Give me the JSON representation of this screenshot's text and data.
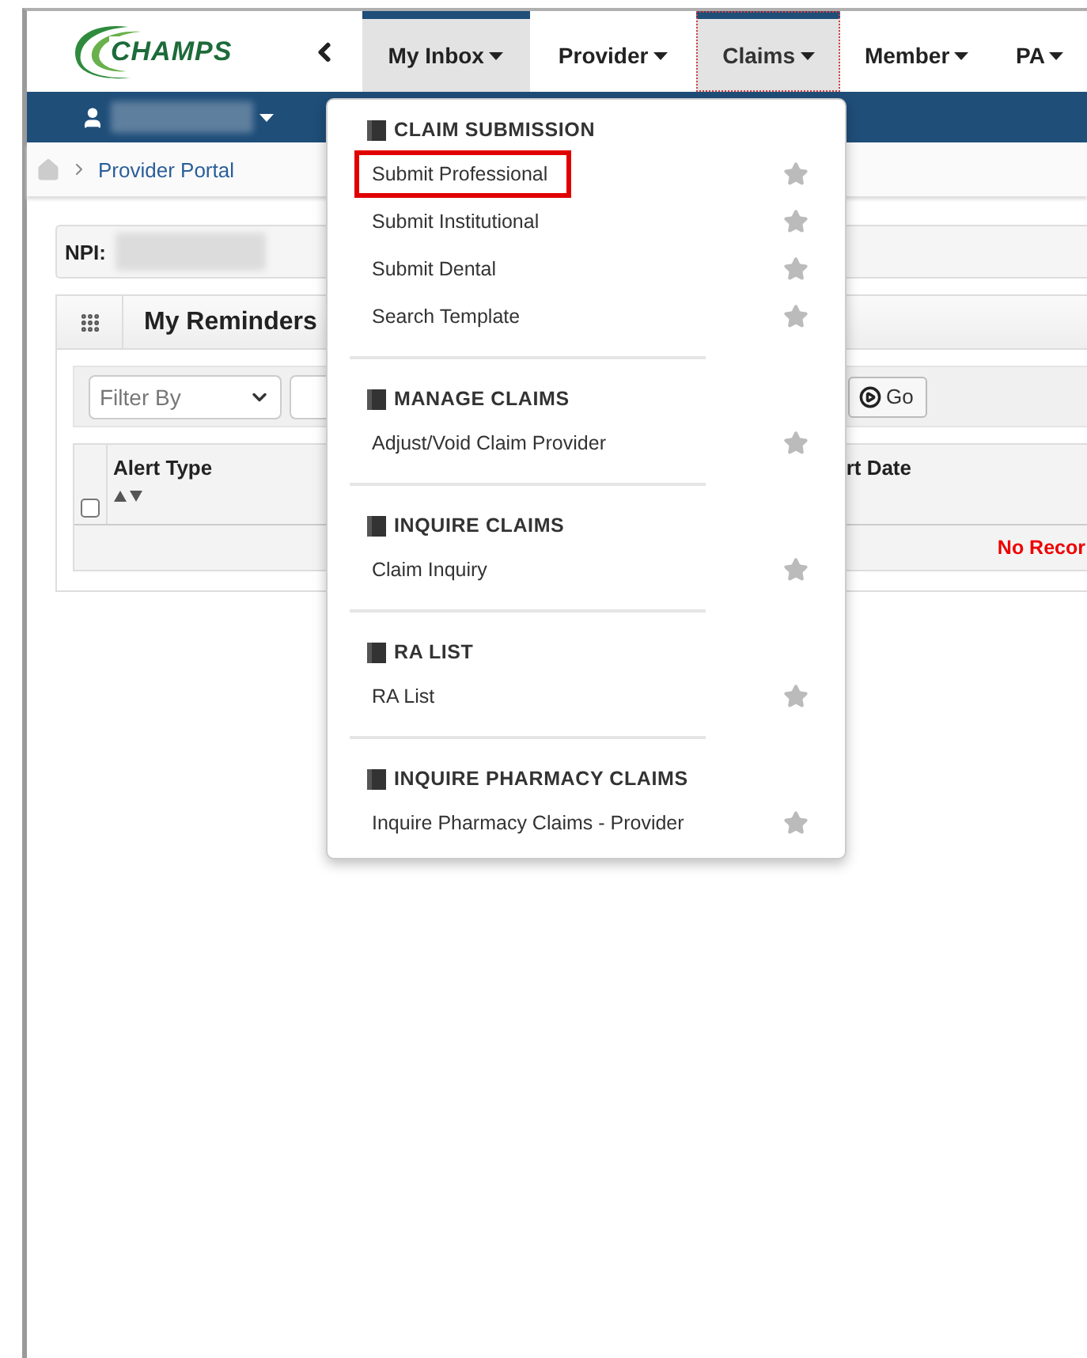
{
  "logo": {
    "text": "CHAMPS"
  },
  "nav_tabs": [
    {
      "label": "My Inbox",
      "selected": true,
      "open": false
    },
    {
      "label": "Provider",
      "selected": false,
      "open": false
    },
    {
      "label": "Claims",
      "selected": true,
      "open": true
    },
    {
      "label": "Member",
      "selected": false,
      "open": false
    },
    {
      "label": "PA",
      "selected": false,
      "open": false
    }
  ],
  "breadcrumb": {
    "items": [
      "Provider Portal"
    ]
  },
  "npi": {
    "label": "NPI:"
  },
  "reminders": {
    "title": "My Reminders",
    "filter": {
      "value": "Filter By"
    },
    "select_all_checked": false,
    "go_button": "Go",
    "columns": [
      "Alert Type",
      "rt Date"
    ],
    "empty_message": "No Recor"
  },
  "claims_menu": {
    "sections": [
      {
        "title": "CLAIM SUBMISSION",
        "items": [
          {
            "label": "Submit Professional",
            "highlighted": true
          },
          {
            "label": "Submit Institutional",
            "highlighted": false
          },
          {
            "label": "Submit Dental",
            "highlighted": false
          },
          {
            "label": "Search Template",
            "highlighted": false
          }
        ]
      },
      {
        "title": "MANAGE CLAIMS",
        "items": [
          {
            "label": "Adjust/Void Claim Provider",
            "highlighted": false
          }
        ]
      },
      {
        "title": "INQUIRE CLAIMS",
        "items": [
          {
            "label": "Claim Inquiry",
            "highlighted": false
          }
        ]
      },
      {
        "title": "RA LIST",
        "items": [
          {
            "label": "RA List",
            "highlighted": false
          }
        ]
      },
      {
        "title": "INQUIRE PHARMACY CLAIMS",
        "items": [
          {
            "label": "Inquire Pharmacy Claims - Provider",
            "highlighted": false
          }
        ]
      }
    ]
  }
}
